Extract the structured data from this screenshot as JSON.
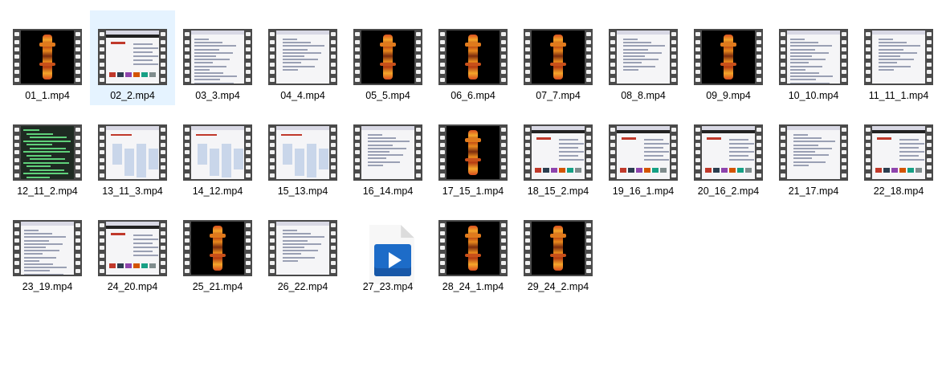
{
  "files": [
    {
      "name": "01_1.mp4",
      "thumb": "totem"
    },
    {
      "name": "02_2.mp4",
      "thumb": "shop",
      "selected": true
    },
    {
      "name": "03_3.mp4",
      "thumb": "list"
    },
    {
      "name": "04_4.mp4",
      "thumb": "doc"
    },
    {
      "name": "05_5.mp4",
      "thumb": "totem"
    },
    {
      "name": "06_6.mp4",
      "thumb": "totem"
    },
    {
      "name": "07_7.mp4",
      "thumb": "totem"
    },
    {
      "name": "08_8.mp4",
      "thumb": "doc"
    },
    {
      "name": "09_9.mp4",
      "thumb": "totem"
    },
    {
      "name": "10_10.mp4",
      "thumb": "list"
    },
    {
      "name": "11_11_1.mp4",
      "thumb": "doc"
    },
    {
      "name": "12_11_2.mp4",
      "thumb": "term"
    },
    {
      "name": "13_11_3.mp4",
      "thumb": "blue"
    },
    {
      "name": "14_12.mp4",
      "thumb": "blue"
    },
    {
      "name": "15_13.mp4",
      "thumb": "blue"
    },
    {
      "name": "16_14.mp4",
      "thumb": "doc"
    },
    {
      "name": "17_15_1.mp4",
      "thumb": "totem"
    },
    {
      "name": "18_15_2.mp4",
      "thumb": "shop"
    },
    {
      "name": "19_16_1.mp4",
      "thumb": "shop"
    },
    {
      "name": "20_16_2.mp4",
      "thumb": "shop"
    },
    {
      "name": "21_17.mp4",
      "thumb": "doc"
    },
    {
      "name": "22_18.mp4",
      "thumb": "shop"
    },
    {
      "name": "23_19.mp4",
      "thumb": "list"
    },
    {
      "name": "24_20.mp4",
      "thumb": "shop"
    },
    {
      "name": "25_21.mp4",
      "thumb": "totem"
    },
    {
      "name": "26_22.mp4",
      "thumb": "doc"
    },
    {
      "name": "27_23.mp4",
      "thumb": "generic"
    },
    {
      "name": "28_24_1.mp4",
      "thumb": "totem"
    },
    {
      "name": "29_24_2.mp4",
      "thumb": "totem"
    }
  ],
  "colors": {
    "selected_bg": "#cce8ff",
    "reel": "#4a4a4a",
    "generic_icon": "#1d6cc8"
  }
}
